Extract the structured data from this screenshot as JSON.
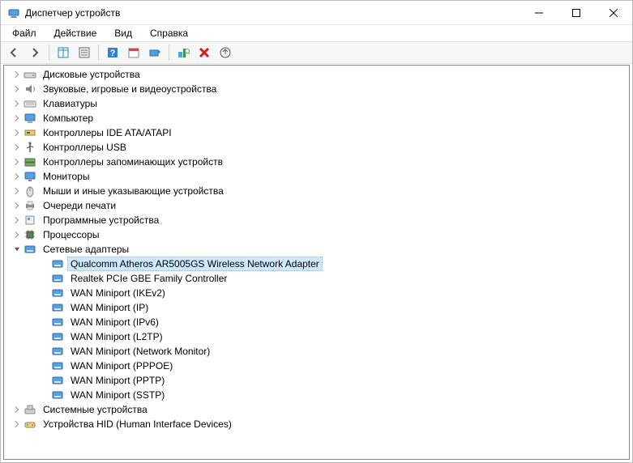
{
  "window": {
    "title": "Диспетчер устройств"
  },
  "menu": {
    "file": "Файл",
    "action": "Действие",
    "view": "Вид",
    "help": "Справка"
  },
  "toolbar": {
    "back": "Back",
    "forward": "Forward",
    "details": "Details",
    "properties": "Properties",
    "help": "Help",
    "calendar": "Event",
    "update": "Update driver",
    "scan": "Scan for hardware changes",
    "uninstall": "Uninstall",
    "eject": "Eject"
  },
  "tree": {
    "categories": [
      {
        "label": "Дисковые устройства",
        "icon": "disk",
        "expanded": false
      },
      {
        "label": "Звуковые, игровые и видеоустройства",
        "icon": "audio",
        "expanded": false
      },
      {
        "label": "Клавиатуры",
        "icon": "keyboard",
        "expanded": false
      },
      {
        "label": "Компьютер",
        "icon": "computer",
        "expanded": false
      },
      {
        "label": "Контроллеры IDE ATA/ATAPI",
        "icon": "ide",
        "expanded": false
      },
      {
        "label": "Контроллеры USB",
        "icon": "usb",
        "expanded": false
      },
      {
        "label": "Контроллеры запоминающих устройств",
        "icon": "storage",
        "expanded": false
      },
      {
        "label": "Мониторы",
        "icon": "monitor",
        "expanded": false
      },
      {
        "label": "Мыши и иные указывающие устройства",
        "icon": "mouse",
        "expanded": false
      },
      {
        "label": "Очереди печати",
        "icon": "printer",
        "expanded": false
      },
      {
        "label": "Программные устройства",
        "icon": "soft",
        "expanded": false
      },
      {
        "label": "Процессоры",
        "icon": "cpu",
        "expanded": false
      },
      {
        "label": "Сетевые адаптеры",
        "icon": "net",
        "expanded": true,
        "children": [
          {
            "label": "Qualcomm Atheros AR5005GS Wireless Network Adapter",
            "selected": true
          },
          {
            "label": "Realtek PCIe GBE Family Controller"
          },
          {
            "label": "WAN Miniport (IKEv2)"
          },
          {
            "label": "WAN Miniport (IP)"
          },
          {
            "label": "WAN Miniport (IPv6)"
          },
          {
            "label": "WAN Miniport (L2TP)"
          },
          {
            "label": "WAN Miniport (Network Monitor)"
          },
          {
            "label": "WAN Miniport (PPPOE)"
          },
          {
            "label": "WAN Miniport (PPTP)"
          },
          {
            "label": "WAN Miniport (SSTP)"
          }
        ]
      },
      {
        "label": "Системные устройства",
        "icon": "system",
        "expanded": false
      },
      {
        "label": "Устройства HID (Human Interface Devices)",
        "icon": "hid",
        "expanded": false
      }
    ]
  }
}
